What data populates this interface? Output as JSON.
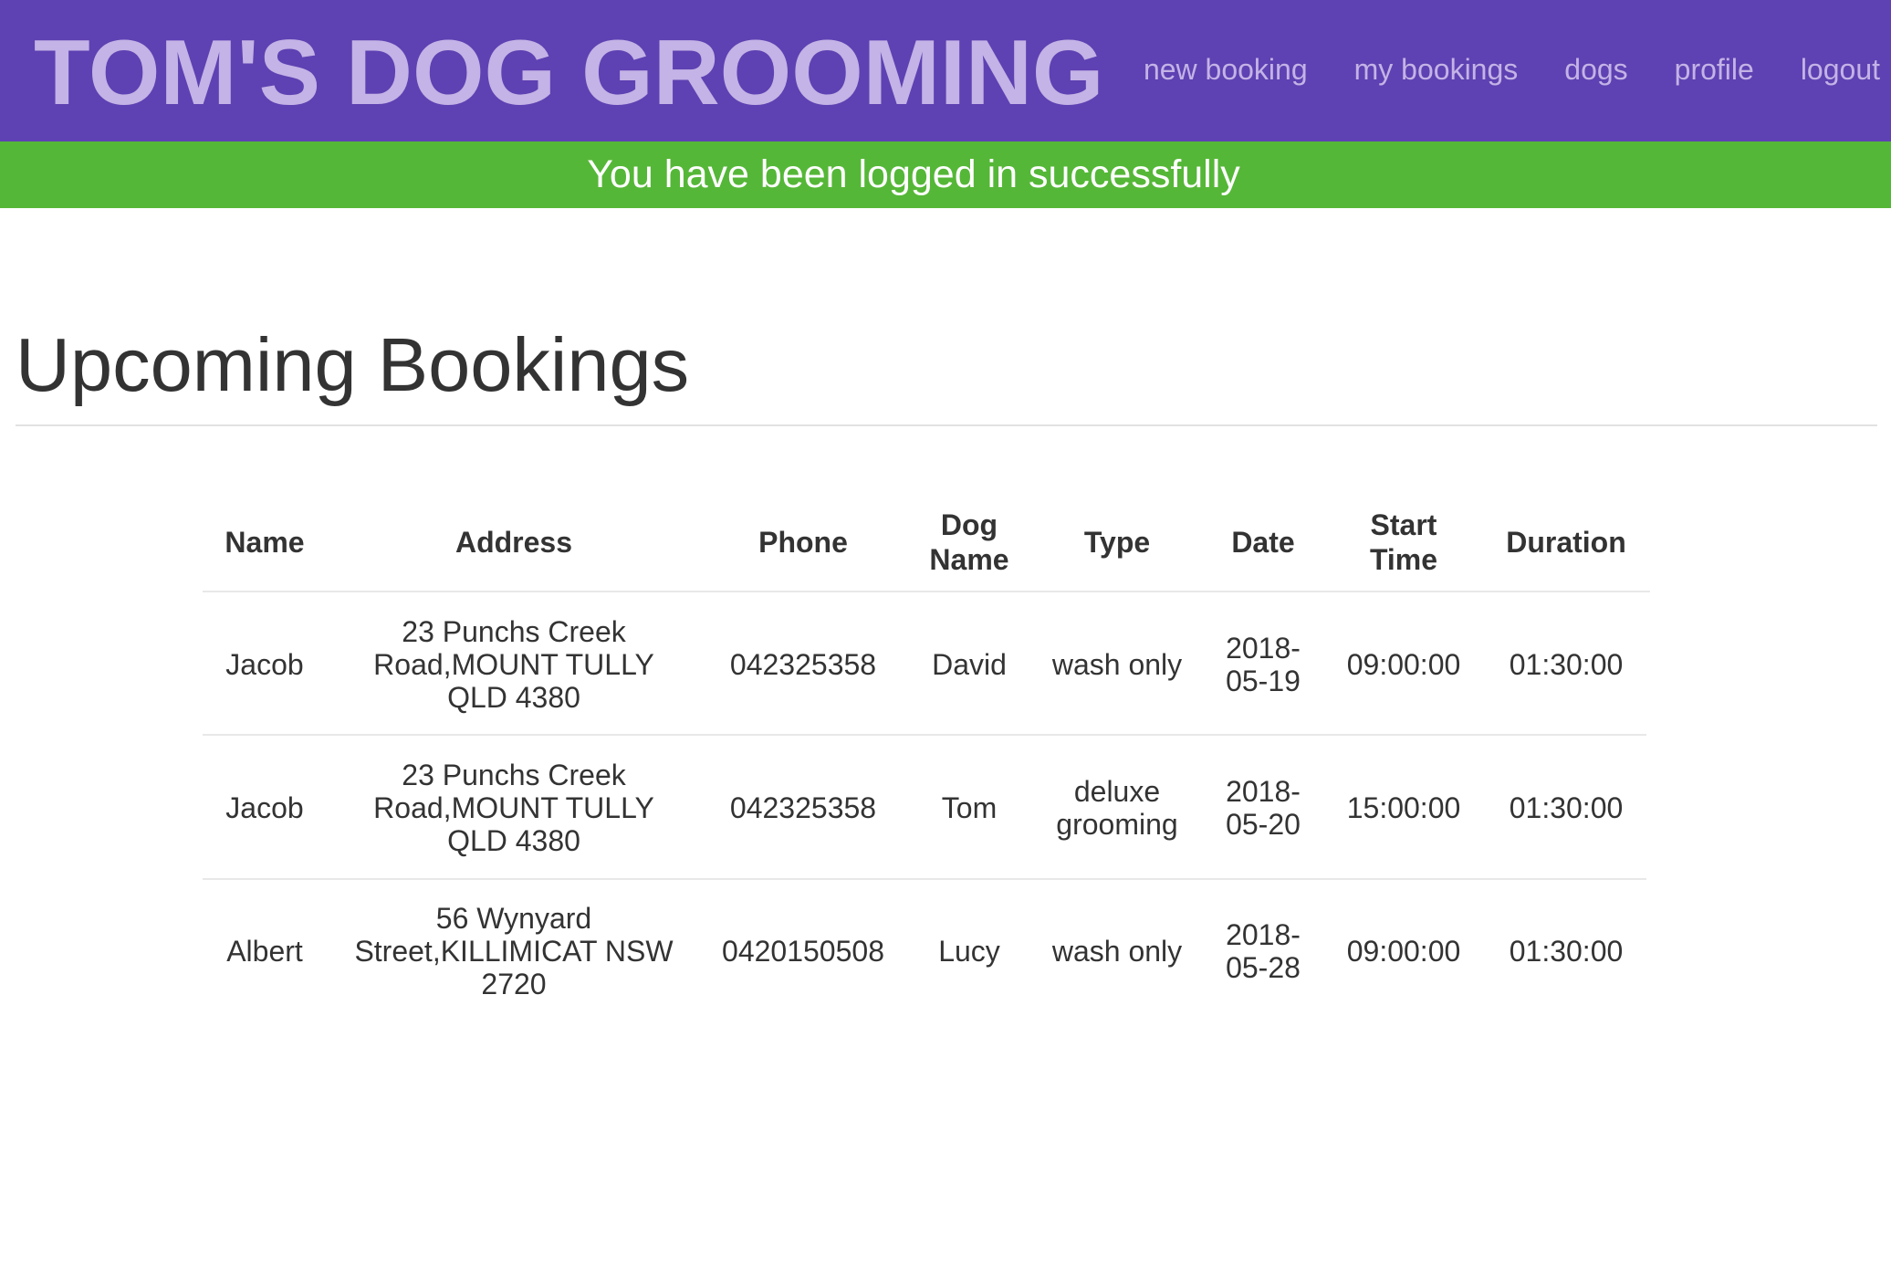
{
  "header": {
    "brand": "TOM'S DOG GROOMING",
    "nav": [
      {
        "label": "new booking"
      },
      {
        "label": "my bookings"
      },
      {
        "label": "dogs"
      },
      {
        "label": "profile"
      },
      {
        "label": "logout"
      }
    ]
  },
  "alert": {
    "message": "You have been logged in successfully"
  },
  "main": {
    "title": "Upcoming Bookings",
    "table": {
      "columns": [
        "Name",
        "Address",
        "Phone",
        "Dog Name",
        "Type",
        "Date",
        "Start Time",
        "Duration"
      ],
      "rows": [
        {
          "name": "Jacob",
          "address": "23 Punchs Creek Road,MOUNT TULLY QLD 4380",
          "phone": "042325358",
          "dog_name": "David",
          "type": "wash only",
          "date": "2018-05-19",
          "start_time": "09:00:00",
          "duration": "01:30:00"
        },
        {
          "name": "Jacob",
          "address": "23 Punchs Creek Road,MOUNT TULLY QLD 4380",
          "phone": "042325358",
          "dog_name": "Tom",
          "type": "deluxe grooming",
          "date": "2018-05-20",
          "start_time": "15:00:00",
          "duration": "01:30:00"
        },
        {
          "name": "Albert",
          "address": "56 Wynyard Street,KILLIMICAT NSW 2720",
          "phone": "0420150508",
          "dog_name": "Lucy",
          "type": "wash only",
          "date": "2018-05-28",
          "start_time": "09:00:00",
          "duration": "01:30:00"
        }
      ]
    }
  },
  "colors": {
    "header_bg": "#5e41b2",
    "brand_text": "#c3b3e6",
    "alert_bg": "#55b737",
    "alert_text": "#ffffff",
    "body_text": "#333333"
  }
}
